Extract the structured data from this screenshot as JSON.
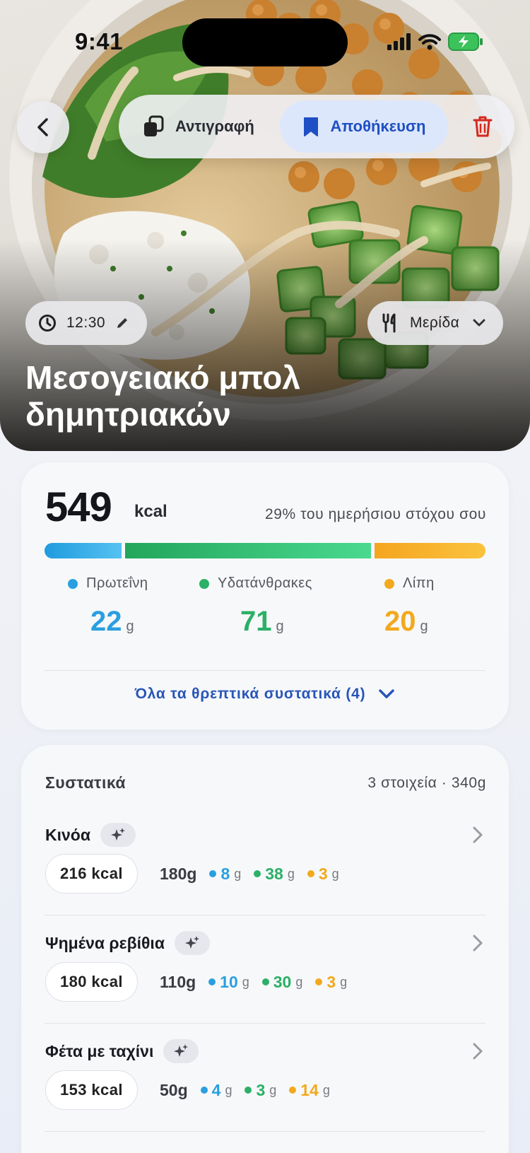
{
  "status_bar": {
    "time": "9:41"
  },
  "toolbar": {
    "copy_label": "Αντιγραφή",
    "save_label": "Αποθήκευση"
  },
  "meal": {
    "time": "12:30",
    "portion_label": "Μερίδα",
    "title": "Μεσογειακό μπολ δημητριακών"
  },
  "nutrition": {
    "kcal": "549",
    "kcal_unit": "kcal",
    "goal_text": "29% του ημερήσιου στόχου σου",
    "bar_fractions": {
      "protein": 0.16,
      "carbs": 0.51,
      "fat": 0.23
    },
    "macros": [
      {
        "label": "Πρωτεΐνη",
        "value": "22",
        "unit": "g",
        "color": "#2a9fe0"
      },
      {
        "label": "Υδατάνθρακες",
        "value": "71",
        "unit": "g",
        "color": "#2bb067"
      },
      {
        "label": "Λίπη",
        "value": "20",
        "unit": "g",
        "color": "#f2a91e"
      }
    ],
    "all_nutrients_label": "Όλα τα θρεπτικά συστατικά (4)"
  },
  "ingredients": {
    "title": "Συστατικά",
    "summary": "3 στοιχεία · 340g",
    "items": [
      {
        "name": "Κινόα",
        "kcal": "216 kcal",
        "grams": "180g",
        "protein": "8",
        "carbs": "38",
        "fat": "3",
        "unit": "g"
      },
      {
        "name": "Ψημένα ρεβίθια",
        "kcal": "180 kcal",
        "grams": "110g",
        "protein": "10",
        "carbs": "30",
        "fat": "3",
        "unit": "g"
      },
      {
        "name": "Φέτα με ταχίνι",
        "kcal": "153 kcal",
        "grams": "50g",
        "protein": "4",
        "carbs": "3",
        "fat": "14",
        "unit": "g"
      }
    ]
  },
  "icons": [
    "back-icon",
    "copy-icon",
    "bookmark-icon",
    "trash-icon",
    "clock-icon",
    "pencil-icon",
    "fork-knife-icon",
    "chevron-down-icon",
    "sparkle-icon",
    "chevron-right-icon",
    "signal-icon",
    "wifi-icon",
    "battery-icon"
  ]
}
